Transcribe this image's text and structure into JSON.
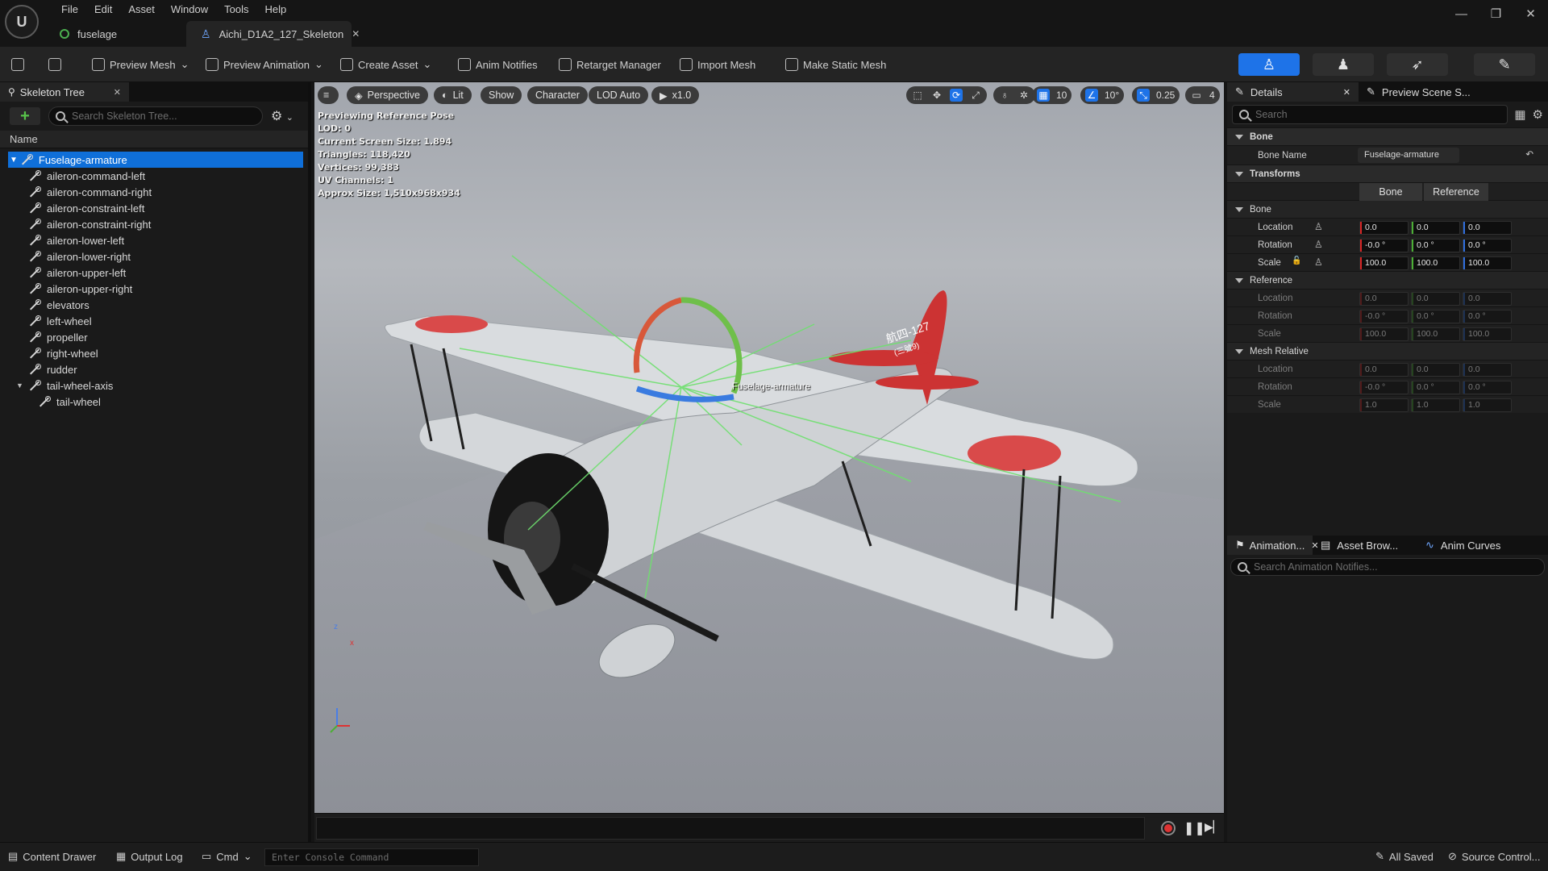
{
  "menu": [
    "File",
    "Edit",
    "Asset",
    "Window",
    "Tools",
    "Help"
  ],
  "doc_tabs": [
    {
      "label": "fuselage"
    },
    {
      "label": "Aichi_D1A2_127_Skeleton"
    }
  ],
  "toolbar": {
    "preview_mesh": "Preview Mesh",
    "preview_animation": "Preview Animation",
    "create_asset": "Create Asset",
    "anim_notifies": "Anim Notifies",
    "retarget_manager": "Retarget Manager",
    "import_mesh": "Import Mesh",
    "make_static_mesh": "Make Static Mesh",
    "accent": "#1e73e8"
  },
  "skeleton_tree": {
    "tab_label": "Skeleton Tree",
    "search_placeholder": "Search Skeleton Tree...",
    "column_name": "Name",
    "root": "Fuselage-armature",
    "bones": [
      "aileron-command-left",
      "aileron-command-right",
      "aileron-constraint-left",
      "aileron-constraint-right",
      "aileron-lower-left",
      "aileron-lower-right",
      "aileron-upper-left",
      "aileron-upper-right",
      "elevators",
      "left-wheel",
      "propeller",
      "right-wheel",
      "rudder",
      "tail-wheel-axis"
    ],
    "child_bone": "tail-wheel"
  },
  "viewport": {
    "perspective": "Perspective",
    "lit": "Lit",
    "show": "Show",
    "character": "Character",
    "lod": "LOD Auto",
    "speed": "x1.0",
    "grid_snap": "10",
    "angle_snap": "10°",
    "scale_snap": "0.25",
    "camera_speed": "4",
    "info": [
      "Previewing Reference Pose",
      "LOD: 0",
      "Current Screen Size: 1.894",
      "Triangles: 118,420",
      "Vertices: 99,383",
      "UV Channels: 1",
      "Approx Size: 1,510x968x934"
    ],
    "bone_label": "Fuselage-armature",
    "aircraft_code": "航四-127",
    "aircraft_sub": "(三號9)",
    "axis_z": "z",
    "axis_x": "x"
  },
  "details": {
    "tab_label": "Details",
    "tab2_label": "Preview Scene S...",
    "search_placeholder": "Search",
    "section_bone": "Bone",
    "bone_name_label": "Bone Name",
    "bone_name_value": "Fuselage-armature",
    "section_transforms": "Transforms",
    "seg_bone": "Bone",
    "seg_reference": "Reference",
    "sub_bone": "Bone",
    "sub_reference": "Reference",
    "sub_mesh_relative": "Mesh Relative",
    "labels": {
      "location": "Location",
      "rotation": "Rotation",
      "scale": "Scale"
    },
    "bone_values": {
      "location": [
        "0.0",
        "0.0",
        "0.0"
      ],
      "rotation": [
        "-0.0 °",
        "0.0 °",
        "0.0 °"
      ],
      "scale": [
        "100.0",
        "100.0",
        "100.0"
      ]
    },
    "reference_values": {
      "location": [
        "0.0",
        "0.0",
        "0.0"
      ],
      "rotation": [
        "-0.0 °",
        "0.0 °",
        "0.0 °"
      ],
      "scale": [
        "100.0",
        "100.0",
        "100.0"
      ]
    },
    "mesh_relative_values": {
      "location": [
        "0.0",
        "0.0",
        "0.0"
      ],
      "rotation": [
        "-0.0 °",
        "0.0 °",
        "0.0 °"
      ],
      "scale": [
        "1.0",
        "1.0",
        "1.0"
      ]
    }
  },
  "bottom_right": {
    "tab_animation": "Animation...",
    "tab_asset_browser": "Asset Brow...",
    "tab_anim_curves": "Anim Curves",
    "search_placeholder": "Search Animation Notifies..."
  },
  "statusbar": {
    "content_drawer": "Content Drawer",
    "output_log": "Output Log",
    "cmd": "Cmd",
    "console_placeholder": "Enter Console Command",
    "all_saved": "All Saved",
    "source_control": "Source Control..."
  }
}
